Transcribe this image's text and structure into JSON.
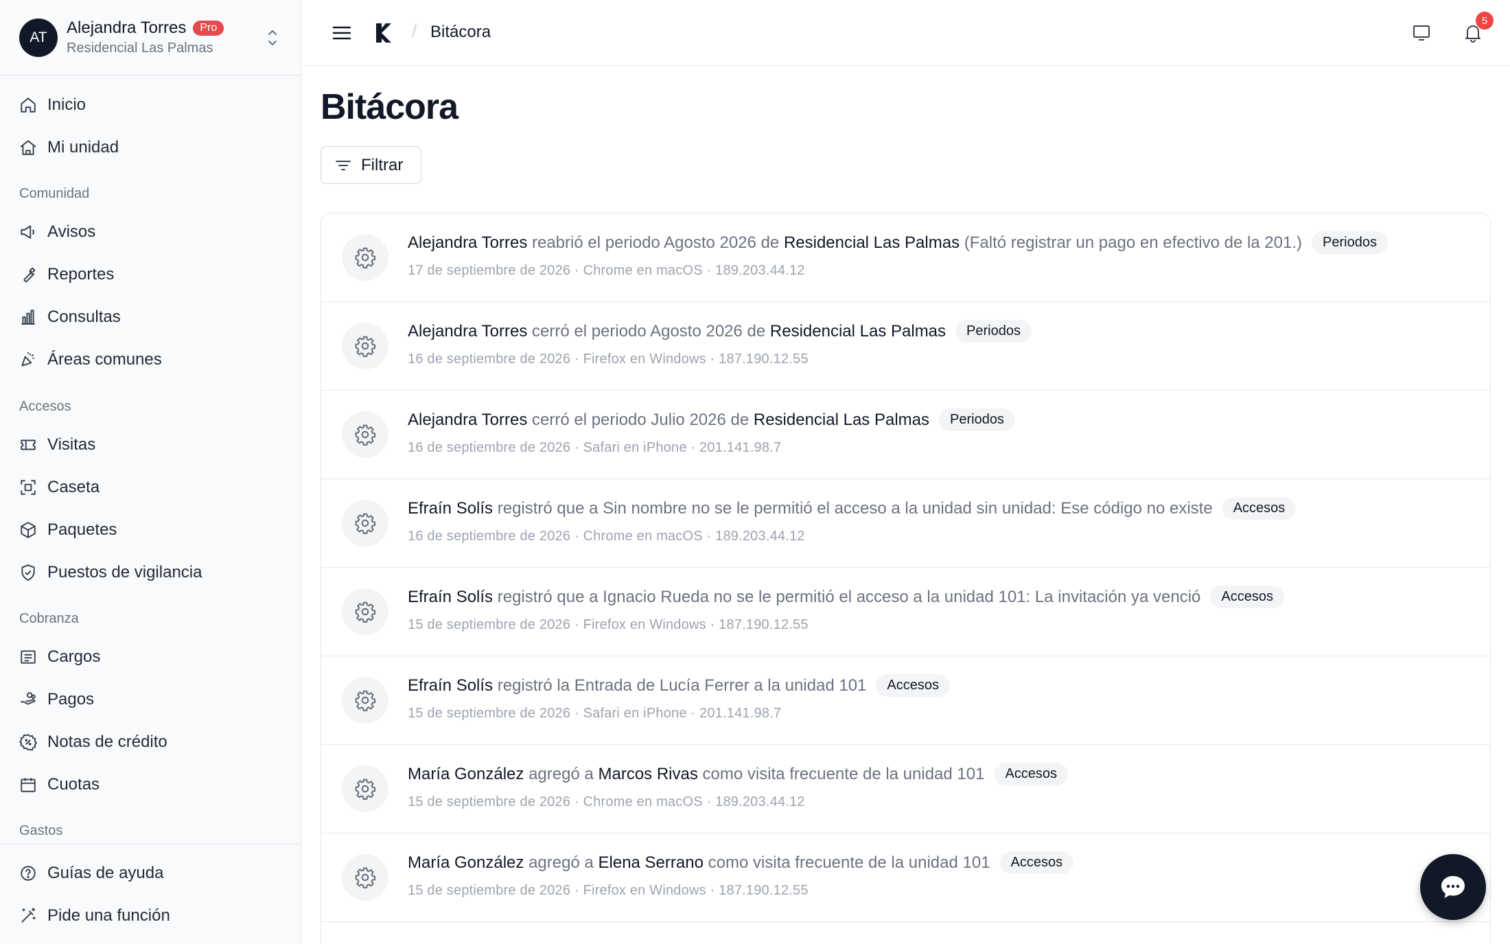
{
  "account": {
    "initials": "AT",
    "name": "Alejandra Torres",
    "badge": "Pro",
    "community": "Residencial Las Palmas"
  },
  "sidebar": {
    "top_items": [
      {
        "label": "Inicio",
        "icon": "home-icon"
      },
      {
        "label": "Mi unidad",
        "icon": "house-icon"
      }
    ],
    "sections": [
      {
        "title": "Comunidad",
        "items": [
          {
            "label": "Avisos",
            "icon": "megaphone-icon"
          },
          {
            "label": "Reportes",
            "icon": "wrench-icon"
          },
          {
            "label": "Consultas",
            "icon": "bar-chart-icon"
          },
          {
            "label": "Áreas comunes",
            "icon": "party-icon"
          }
        ]
      },
      {
        "title": "Accesos",
        "items": [
          {
            "label": "Visitas",
            "icon": "ticket-icon"
          },
          {
            "label": "Caseta",
            "icon": "scan-icon"
          },
          {
            "label": "Paquetes",
            "icon": "package-icon"
          },
          {
            "label": "Puestos de vigilancia",
            "icon": "shield-check-icon"
          }
        ]
      },
      {
        "title": "Cobranza",
        "items": [
          {
            "label": "Cargos",
            "icon": "receipt-icon"
          },
          {
            "label": "Pagos",
            "icon": "hand-coins-icon"
          },
          {
            "label": "Notas de crédito",
            "icon": "badge-percent-icon"
          },
          {
            "label": "Cuotas",
            "icon": "calendar-icon"
          }
        ]
      },
      {
        "title": "Gastos",
        "items": []
      }
    ],
    "bottom_items": [
      {
        "label": "Guías de ayuda",
        "icon": "help-circle-icon"
      },
      {
        "label": "Pide una función",
        "icon": "magic-wand-icon"
      }
    ]
  },
  "topbar": {
    "breadcrumb": "Bitácora",
    "notification_count": "5"
  },
  "page": {
    "title": "Bitácora",
    "filter_label": "Filtrar"
  },
  "log_entries": [
    {
      "parts": [
        {
          "t": "Alejandra Torres",
          "b": true
        },
        {
          "t": " reabrió el periodo Agosto 2026 de ",
          "b": false
        },
        {
          "t": "Residencial Las Palmas",
          "b": true
        },
        {
          "t": " (Faltó registrar un pago en efectivo de la 201.)",
          "b": false
        }
      ],
      "tag": "Periodos",
      "date": "17 de septiembre de 2026",
      "client": "Chrome en macOS",
      "ip": "189.203.44.12"
    },
    {
      "parts": [
        {
          "t": "Alejandra Torres",
          "b": true
        },
        {
          "t": " cerró el periodo Agosto 2026 de ",
          "b": false
        },
        {
          "t": "Residencial Las Palmas",
          "b": true
        }
      ],
      "tag": "Periodos",
      "date": "16 de septiembre de 2026",
      "client": "Firefox en Windows",
      "ip": "187.190.12.55"
    },
    {
      "parts": [
        {
          "t": "Alejandra Torres",
          "b": true
        },
        {
          "t": " cerró el periodo Julio 2026 de ",
          "b": false
        },
        {
          "t": "Residencial Las Palmas",
          "b": true
        }
      ],
      "tag": "Periodos",
      "date": "16 de septiembre de 2026",
      "client": "Safari en iPhone",
      "ip": "201.141.98.7"
    },
    {
      "parts": [
        {
          "t": "Efraín Solís",
          "b": true
        },
        {
          "t": " registró que a Sin nombre no se le permitió el acceso a la unidad sin unidad: Ese código no existe",
          "b": false
        }
      ],
      "tag": "Accesos",
      "date": "16 de septiembre de 2026",
      "client": "Chrome en macOS",
      "ip": "189.203.44.12"
    },
    {
      "parts": [
        {
          "t": "Efraín Solís",
          "b": true
        },
        {
          "t": " registró que a Ignacio Rueda no se le permitió el acceso a la unidad 101: La invitación ya venció",
          "b": false
        }
      ],
      "tag": "Accesos",
      "date": "15 de septiembre de 2026",
      "client": "Firefox en Windows",
      "ip": "187.190.12.55"
    },
    {
      "parts": [
        {
          "t": "Efraín Solís",
          "b": true
        },
        {
          "t": " registró la Entrada de Lucía Ferrer a la unidad 101",
          "b": false
        }
      ],
      "tag": "Accesos",
      "date": "15 de septiembre de 2026",
      "client": "Safari en iPhone",
      "ip": "201.141.98.7"
    },
    {
      "parts": [
        {
          "t": "María González",
          "b": true
        },
        {
          "t": " agregó a ",
          "b": false
        },
        {
          "t": "Marcos Rivas",
          "b": true
        },
        {
          "t": " como visita frecuente de la unidad 101",
          "b": false
        }
      ],
      "tag": "Accesos",
      "date": "15 de septiembre de 2026",
      "client": "Chrome en macOS",
      "ip": "189.203.44.12"
    },
    {
      "parts": [
        {
          "t": "María González",
          "b": true
        },
        {
          "t": " agregó a ",
          "b": false
        },
        {
          "t": "Elena Serrano",
          "b": true
        },
        {
          "t": " como visita frecuente de la unidad 101",
          "b": false
        }
      ],
      "tag": "Accesos",
      "date": "15 de septiembre de 2026",
      "client": "Firefox en Windows",
      "ip": "187.190.12.55"
    }
  ],
  "colors": {
    "accent": "#111827",
    "pro_badge": "#e5484d",
    "notification": "#ef4444",
    "muted_text": "#6b7280"
  }
}
